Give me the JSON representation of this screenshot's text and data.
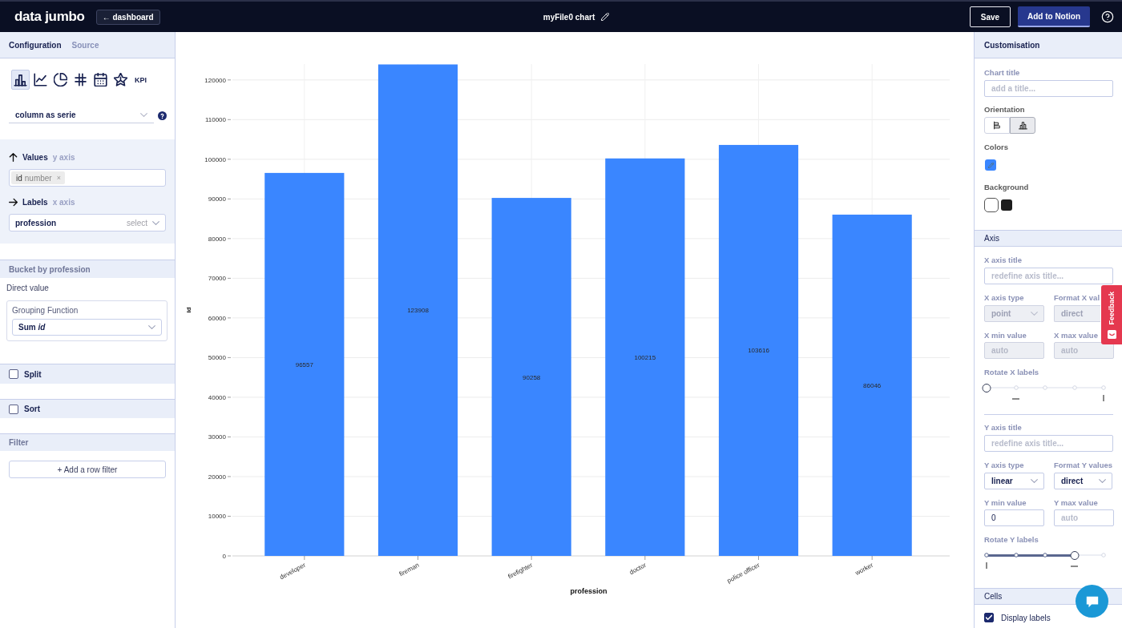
{
  "header": {
    "logo": "data jumbo",
    "back_button": "← dashboard",
    "title": "myFile0 chart",
    "buttons": [
      {
        "label": "Save",
        "kind": "outline"
      },
      {
        "label": "Add to Notion",
        "kind": "primary"
      }
    ]
  },
  "left_panel": {
    "tabs": [
      {
        "label": "Configuration",
        "selected": true
      },
      {
        "label": "Source",
        "selected": false
      }
    ],
    "chart_types": [
      {
        "kind": "bar",
        "selected": true
      },
      {
        "kind": "line",
        "selected": false
      },
      {
        "kind": "pie",
        "selected": false
      },
      {
        "kind": "grid",
        "selected": false
      },
      {
        "kind": "calendar",
        "selected": false
      },
      {
        "kind": "star",
        "selected": false
      },
      {
        "kind": "text",
        "label": "KPI",
        "selected": false
      }
    ],
    "series_mode": {
      "value": "column as serie"
    },
    "values": {
      "title": "Values",
      "hint": "y axis",
      "chips": [
        {
          "name": "id",
          "type": "number",
          "remove": "×"
        }
      ]
    },
    "labels": {
      "title": "Labels",
      "hint": "x axis",
      "value": "profession",
      "action": "select"
    },
    "bucket": {
      "title": "Bucket by profession",
      "mode": "Direct value",
      "grouping": {
        "label": "Grouping Function",
        "value": "Sum *id*"
      }
    },
    "toggles": [
      {
        "label": "Split",
        "checked": false
      },
      {
        "label": "Sort",
        "checked": false
      }
    ],
    "filter": {
      "title": "Filter",
      "button": "+ Add a row filter"
    }
  },
  "chart": {
    "chart_data": [
      {
        "type": "bar",
        "categories": [
          "developer",
          "fireman",
          "firefighter",
          "doctor",
          "police officer",
          "worker"
        ],
        "values": [
          96557,
          123908,
          90258,
          100215,
          103616,
          86046
        ],
        "color": "#3a86ff",
        "xlabel": "profession",
        "ylabel": "id",
        "yticks": [
          0,
          10000,
          20000,
          30000,
          40000,
          50000,
          60000,
          70000,
          80000,
          90000,
          100000,
          110000,
          120000
        ],
        "ylim": [
          0,
          124000
        ],
        "grid": true,
        "data_labels": true
      }
    ]
  },
  "right_panel": {
    "title": "Customisation",
    "chart_title": {
      "label": "Chart title",
      "placeholder": "add a title..."
    },
    "orientation": {
      "label": "Orientation",
      "options": [
        {
          "kind": "horizontal",
          "selected": false
        },
        {
          "kind": "vertical",
          "selected": true
        }
      ]
    },
    "colors": {
      "label": "Colors",
      "swatches": [
        {
          "color": "#3a86ff"
        }
      ]
    },
    "background": {
      "label": "Background",
      "swatches": [
        {
          "color": "#ffffff",
          "selected": true
        },
        {
          "color": "#1c1c1c",
          "selected": false
        }
      ]
    },
    "axis": {
      "title": "Axis",
      "sections": [
        {
          "title_field": {
            "label": "X axis title",
            "placeholder": "redefine axis title..."
          },
          "fields": [
            {
              "kind": "select",
              "label": "X axis type",
              "value": "point",
              "disabled": true
            },
            {
              "kind": "select",
              "label": "Format X val",
              "value": "direct",
              "disabled": true
            },
            {
              "kind": "input",
              "label": "X min value",
              "placeholder": "auto",
              "disabled": true
            },
            {
              "kind": "input",
              "label": "X max value",
              "placeholder": "auto",
              "disabled": true
            }
          ],
          "rotate": {
            "label": "Rotate X labels",
            "level": 0,
            "stops": [
              {
                "kind": "blank"
              },
              {
                "kind": "dash"
              },
              {
                "kind": "blank"
              },
              {
                "kind": "blank"
              },
              {
                "kind": "bar"
              }
            ]
          }
        },
        {
          "title_field": {
            "label": "Y axis title",
            "placeholder": "redefine axis title..."
          },
          "fields": [
            {
              "kind": "select",
              "label": "Y axis type",
              "value": "linear",
              "disabled": false
            },
            {
              "kind": "select",
              "label": "Format Y values",
              "value": "direct",
              "disabled": false
            },
            {
              "kind": "input",
              "label": "Y min value",
              "value": "0",
              "disabled": false
            },
            {
              "kind": "input",
              "label": "Y max value",
              "placeholder": "auto",
              "disabled": false
            }
          ],
          "rotate": {
            "label": "Rotate Y labels",
            "level": 0.75,
            "stops": [
              {
                "kind": "bar"
              },
              {
                "kind": "blank"
              },
              {
                "kind": "blank"
              },
              {
                "kind": "dash"
              },
              {
                "kind": "blank"
              }
            ]
          }
        }
      ]
    },
    "cells": {
      "title": "Cells",
      "display_labels": {
        "label": "Display labels",
        "checked": true
      }
    }
  },
  "feedback_tab": {
    "label": "Feedback"
  }
}
